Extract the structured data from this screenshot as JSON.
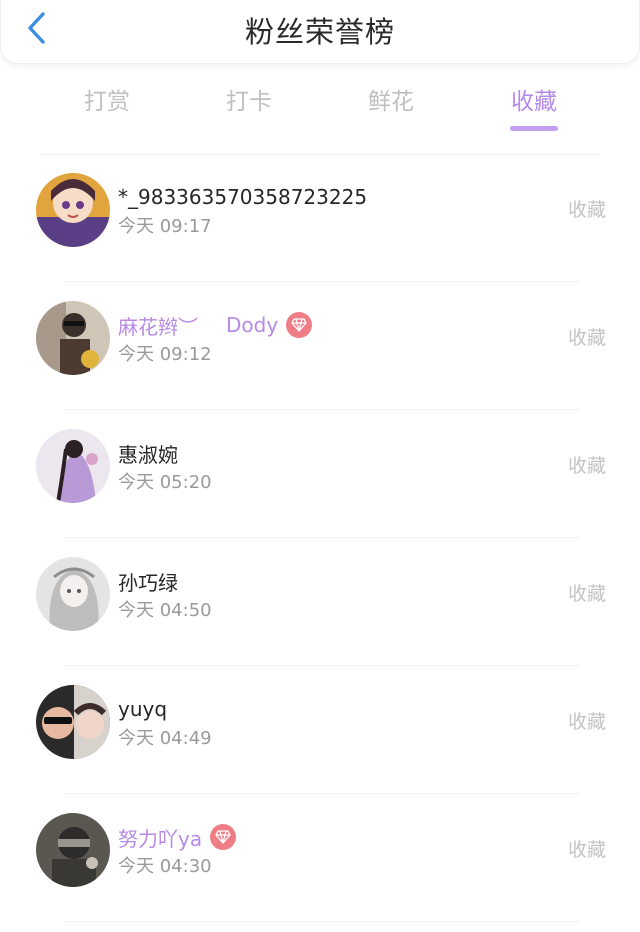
{
  "header": {
    "title": "粉丝荣誉榜",
    "back_icon": "chevron-left-icon",
    "back_color": "#3b8de8"
  },
  "tabs": [
    {
      "label": "打赏",
      "active": false
    },
    {
      "label": "打卡",
      "active": false
    },
    {
      "label": "鲜花",
      "active": false
    },
    {
      "label": "收藏",
      "active": true
    }
  ],
  "accent_color": "#b58be8",
  "badge_icon": "diamond-icon",
  "badge_color": "#ef7d86",
  "fans": [
    {
      "name": "*_983363570358723225",
      "second_name": "",
      "vip": false,
      "badge": false,
      "time": "今天 09:17",
      "action": "收藏"
    },
    {
      "name": "麻花辫︶",
      "second_name": "Dody",
      "vip": true,
      "badge": true,
      "time": "今天 09:12",
      "action": "收藏"
    },
    {
      "name": "惠淑婉",
      "second_name": "",
      "vip": false,
      "badge": false,
      "time": "今天 05:20",
      "action": "收藏"
    },
    {
      "name": "孙巧绿",
      "second_name": "",
      "vip": false,
      "badge": false,
      "time": "今天 04:50",
      "action": "收藏"
    },
    {
      "name": "yuyq",
      "second_name": "",
      "vip": false,
      "badge": false,
      "time": "今天 04:49",
      "action": "收藏"
    },
    {
      "name": "努力吖ya",
      "second_name": "",
      "vip": true,
      "badge": true,
      "time": "今天 04:30",
      "action": "收藏"
    }
  ]
}
